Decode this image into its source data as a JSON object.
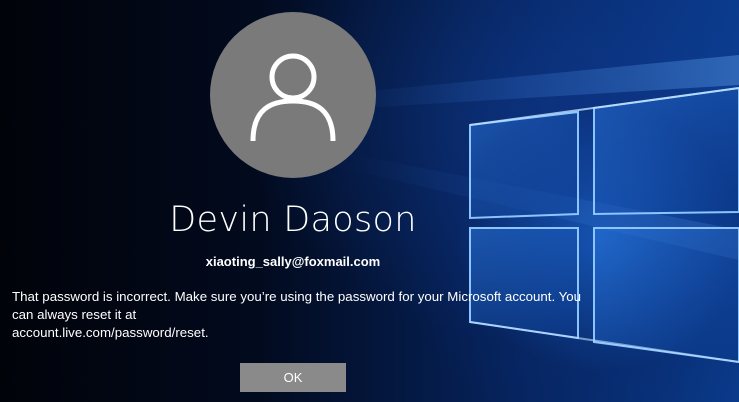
{
  "account": {
    "display_name": "Devin Daoson",
    "email": "xiaoting_sally@foxmail.com",
    "avatar_icon": "person-icon"
  },
  "message": {
    "line1": "That password is incorrect. Make sure you’re using the password for your Microsoft account. You",
    "line2": "can always reset it at",
    "line3": "account.live.com/password/reset."
  },
  "buttons": {
    "ok_label": "OK"
  },
  "wallpaper": {
    "theme": "windows-10-hero",
    "colors": {
      "accent": "#1e6edc",
      "dark": "#02060f",
      "pane": "#1a5cc4"
    }
  }
}
